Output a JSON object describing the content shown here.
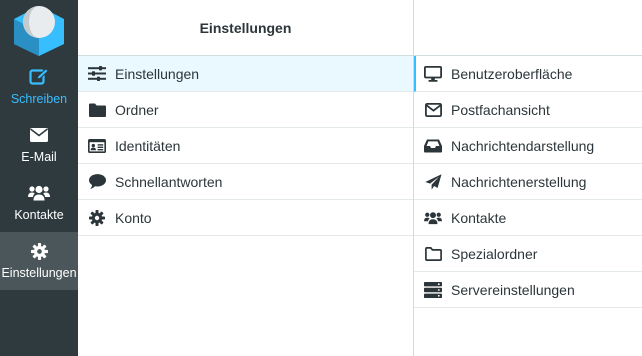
{
  "nav": [
    {
      "key": "compose",
      "label": "Schreiben",
      "icon": "edit-icon"
    },
    {
      "key": "mail",
      "label": "E-Mail",
      "icon": "envelope-icon"
    },
    {
      "key": "contacts",
      "label": "Kontakte",
      "icon": "users-icon"
    },
    {
      "key": "settings",
      "label": "Einstellungen",
      "icon": "gear-icon"
    }
  ],
  "settings_panel": {
    "title": "Einstellungen",
    "items": [
      {
        "label": "Einstellungen",
        "icon": "sliders-icon"
      },
      {
        "label": "Ordner",
        "icon": "folder-icon"
      },
      {
        "label": "Identitäten",
        "icon": "id-card-icon"
      },
      {
        "label": "Schnellantworten",
        "icon": "comment-icon"
      },
      {
        "label": "Konto",
        "icon": "gear-icon"
      }
    ]
  },
  "sections": {
    "items": [
      {
        "label": "Benutzeroberfläche",
        "icon": "desktop-icon"
      },
      {
        "label": "Postfachansicht",
        "icon": "envelope-outline-icon"
      },
      {
        "label": "Nachrichtendarstellung",
        "icon": "inbox-icon"
      },
      {
        "label": "Nachrichtenerstellung",
        "icon": "paper-plane-icon"
      },
      {
        "label": "Kontakte",
        "icon": "users-icon"
      },
      {
        "label": "Spezialordner",
        "icon": "folder-outline-icon"
      },
      {
        "label": "Servereinstellungen",
        "icon": "server-icon"
      }
    ]
  },
  "colors": {
    "rail_bg": "#2f3a3f",
    "rail_active": "#4a565a",
    "accent": "#37beff",
    "selected_row": "#eaf8ff"
  }
}
